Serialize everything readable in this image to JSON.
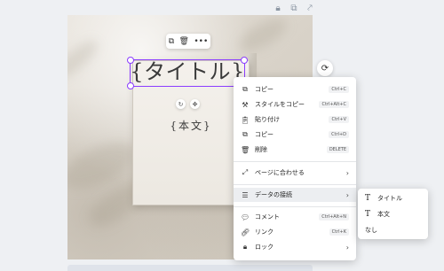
{
  "canvas": {
    "title_text": "{タイトル}",
    "body_text": "{本文}"
  },
  "context_menu": {
    "items": [
      {
        "label": "コピー",
        "shortcut": "Ctrl+C",
        "icon": "copy-icon"
      },
      {
        "label": "スタイルをコピー",
        "shortcut": "Ctrl+Alt+C",
        "icon": "paint-roller-icon"
      },
      {
        "label": "貼り付け",
        "shortcut": "Ctrl+V",
        "icon": "clipboard-icon"
      },
      {
        "label": "コピー",
        "shortcut": "Ctrl+D",
        "icon": "duplicate-icon"
      },
      {
        "label": "削除",
        "shortcut": "DELETE",
        "icon": "trash-icon"
      },
      {
        "label": "ページに合わせる",
        "icon": "fit-page-icon"
      },
      {
        "label": "データの接続",
        "icon": "database-icon"
      },
      {
        "label": "コメント",
        "shortcut": "Ctrl+Alt+N",
        "icon": "comment-icon"
      },
      {
        "label": "リンク",
        "shortcut": "Ctrl+K",
        "icon": "link-icon"
      },
      {
        "label": "ロック",
        "icon": "lock-icon"
      }
    ]
  },
  "submenu": {
    "items": [
      {
        "label": "タイトル",
        "icon": "text-t-icon"
      },
      {
        "label": "本文",
        "icon": "text-t-icon"
      },
      {
        "label": "なし"
      }
    ]
  },
  "colors": {
    "selection": "#8b3dff",
    "menu_active": "#eceef1"
  }
}
